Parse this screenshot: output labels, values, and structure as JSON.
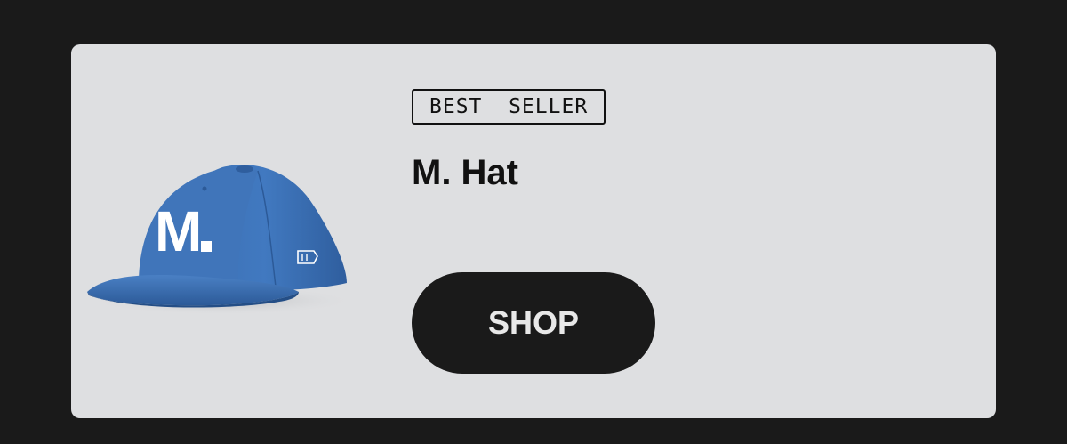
{
  "product": {
    "badge": "BEST  SELLER",
    "name": "M. Hat",
    "cta_label": "SHOP",
    "image": {
      "description": "blue snapback cap icon",
      "cap_letter": "M.",
      "cap_color": "#3f74b8",
      "letter_color": "#ffffff"
    }
  },
  "colors": {
    "page_background": "#1a1a1a",
    "card_background": "#dedfe1",
    "button_background": "#1a1a1a",
    "button_text": "#e8e8e8"
  }
}
